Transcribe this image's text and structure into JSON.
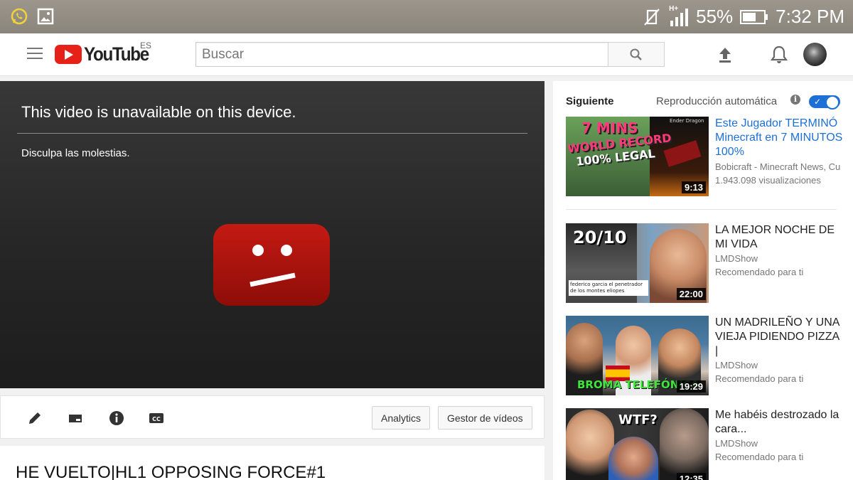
{
  "status_bar": {
    "battery": "55%",
    "time": "7:32 PM",
    "network": "H+"
  },
  "header": {
    "logo_text": "YouTube",
    "region": "ES",
    "search_placeholder": "Buscar"
  },
  "player": {
    "message": "This video is unavailable on this device.",
    "submessage": "Disculpa las molestias."
  },
  "actions": {
    "analytics_label": "Analytics",
    "video_manager_label": "Gestor de vídeos"
  },
  "video": {
    "title": "HE VUELTO|HL1 OPPOSING FORCE#1"
  },
  "sidebar": {
    "next_label": "Siguiente",
    "autoplay_label": "Reproducción automática",
    "autoplay_on": true,
    "recommendations": [
      {
        "title": "Este Jugador TERMINÓ Minecraft en 7 MINUTOS 100%",
        "channel": "Bobicraft - Minecraft News, Cu",
        "meta": "1.943.098 visualizaciones",
        "duration": "9:13",
        "thumb_text": [
          "7 MINS",
          "WORLD RECORD",
          "100% LEGAL",
          "Ender Dragon"
        ]
      },
      {
        "title": "LA MEJOR NOCHE DE MI VIDA",
        "channel": "LMDShow",
        "meta": "Recomendado para ti",
        "duration": "22:00",
        "thumb_text": [
          "20/10",
          "federico garcia el penetrador de los montes eliopes"
        ]
      },
      {
        "title": "UN MADRILEÑO Y UNA VIEJA PIDIENDO PIZZA |",
        "channel": "LMDShow",
        "meta": "Recomendado para ti",
        "duration": "19:29",
        "thumb_text": [
          "BROMA TELEFÓNICA"
        ]
      },
      {
        "title": "Me habéis destrozado la cara...",
        "channel": "LMDShow",
        "meta": "Recomendado para ti",
        "duration": "12:35",
        "thumb_text": [
          "WTF?"
        ]
      }
    ]
  },
  "colors": {
    "youtube_red": "#e62117",
    "link_blue": "#1e6fd6",
    "player_bg": "#262626"
  }
}
